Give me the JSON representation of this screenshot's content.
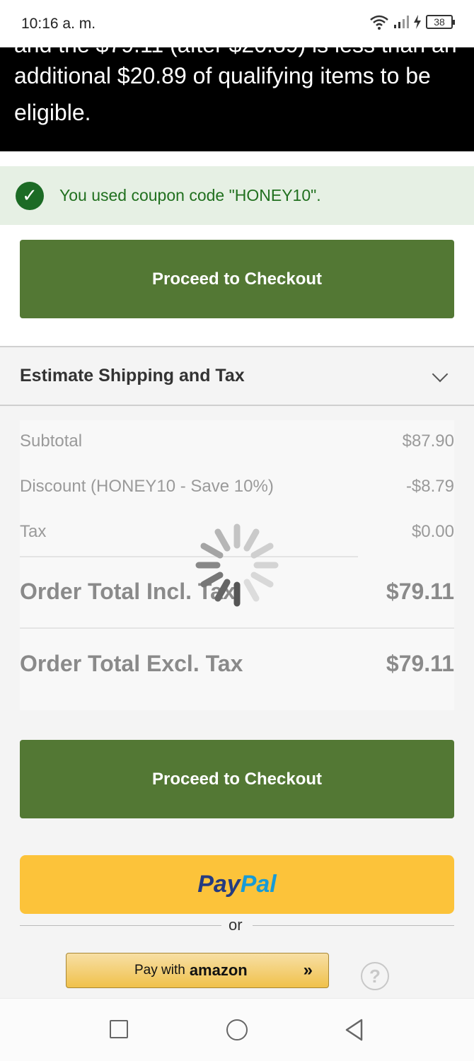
{
  "status_bar": {
    "time": "10:16 a. m.",
    "battery": "38"
  },
  "banner": {
    "cut_line": "and the $79.11 (after $20.89) is less than an",
    "text": "additional $20.89 of qualifying items to be eligible."
  },
  "coupon": {
    "message": "You used coupon code \"HONEY10\"."
  },
  "checkout": {
    "top_label": "Proceed to Checkout",
    "bottom_label": "Proceed to Checkout"
  },
  "shipping": {
    "title": "Estimate Shipping and Tax"
  },
  "totals": {
    "subtotal_label": "Subtotal",
    "subtotal_value": "$87.90",
    "discount_label": "Discount (HONEY10 - Save 10%)",
    "discount_value": "-$8.79",
    "tax_label": "Tax",
    "tax_value": "$0.00",
    "incl_label": "Order Total Incl. Tax",
    "incl_value": "$79.11",
    "excl_label": "Order Total Excl. Tax",
    "excl_value": "$79.11"
  },
  "payment": {
    "paypal_part1": "Pay",
    "paypal_part2": "Pal",
    "or_text": "or",
    "amazon_prefix": "Pay with",
    "amazon_brand": "amazon",
    "amazon_arrow": "»",
    "help_symbol": "?"
  },
  "colors": {
    "checkout_green": "#537834",
    "paypal_yellow": "#fcc33a",
    "coupon_green": "#21701f"
  },
  "icons": [
    "wifi-icon",
    "signal-icon",
    "charging-icon",
    "battery-icon",
    "check-icon",
    "chevron-down-icon",
    "loading-spinner-icon",
    "help-icon",
    "nav-recents-icon",
    "nav-home-icon",
    "nav-back-icon"
  ]
}
